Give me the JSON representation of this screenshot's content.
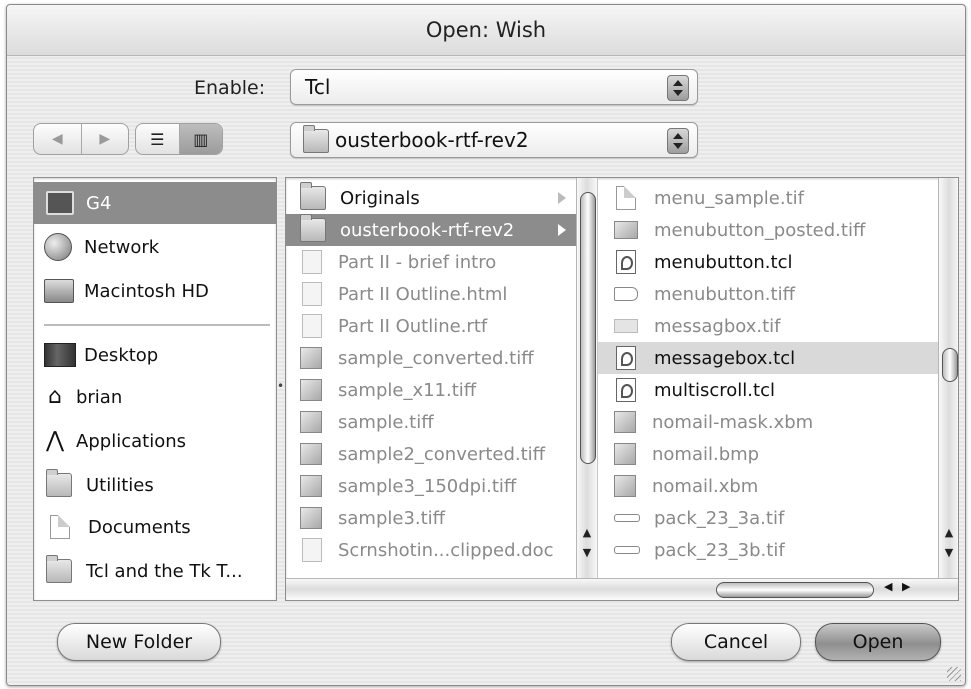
{
  "window": {
    "title": "Open: Wish"
  },
  "enable": {
    "label": "Enable:",
    "value": "Tcl"
  },
  "nav": {
    "back_icon": "back-arrow-icon",
    "forward_icon": "forward-arrow-icon"
  },
  "view": {
    "list_icon": "list-view-icon",
    "column_icon": "column-view-icon",
    "active": "column"
  },
  "location": {
    "value": "ousterbook-rtf-rev2"
  },
  "sidebar": {
    "items": [
      {
        "label": "G4",
        "icon": "computer-icon"
      },
      {
        "label": "Network",
        "icon": "network-globe-icon"
      },
      {
        "label": "Macintosh HD",
        "icon": "hard-disk-icon"
      },
      {
        "label": "Desktop",
        "icon": "desktop-icon"
      },
      {
        "label": "brian",
        "icon": "home-icon"
      },
      {
        "label": "Applications",
        "icon": "applications-icon"
      },
      {
        "label": "Utilities",
        "icon": "folder-icon"
      },
      {
        "label": "Documents",
        "icon": "document-icon"
      },
      {
        "label": "Tcl and the Tk T...",
        "icon": "folder-icon"
      }
    ]
  },
  "column1": {
    "items": [
      {
        "label": "Originals",
        "icon": "folder-icon",
        "enabled": true,
        "has_children": true
      },
      {
        "label": "ousterbook-rtf-rev2",
        "icon": "folder-icon",
        "enabled": true,
        "selected": true,
        "has_children": true
      },
      {
        "label": "Part II - brief intro",
        "icon": "document-icon"
      },
      {
        "label": "Part II Outline.html",
        "icon": "html-document-icon"
      },
      {
        "label": "Part II Outline.rtf",
        "icon": "document-icon"
      },
      {
        "label": "sample_converted.tiff",
        "icon": "image-icon"
      },
      {
        "label": "sample_x11.tiff",
        "icon": "image-icon"
      },
      {
        "label": "sample.tiff",
        "icon": "image-icon"
      },
      {
        "label": "sample2_converted.tiff",
        "icon": "image-icon"
      },
      {
        "label": "sample3_150dpi.tiff",
        "icon": "image-icon"
      },
      {
        "label": "sample3.tiff",
        "icon": "image-icon"
      },
      {
        "label": "Scrnshotin...clipped.doc",
        "icon": "document-icon"
      }
    ]
  },
  "column2": {
    "items": [
      {
        "label": "menu_sample.tif",
        "icon": "document-icon"
      },
      {
        "label": "menubutton_posted.tiff",
        "icon": "image-icon"
      },
      {
        "label": "menubutton.tcl",
        "icon": "tcl-script-icon",
        "enabled": true
      },
      {
        "label": "menubutton.tiff",
        "icon": "image-icon"
      },
      {
        "label": "messagbox.tif",
        "icon": "image-icon"
      },
      {
        "label": "messagebox.tcl",
        "icon": "tcl-script-icon",
        "enabled": true,
        "highlighted": true
      },
      {
        "label": "multiscroll.tcl",
        "icon": "tcl-script-icon",
        "enabled": true
      },
      {
        "label": "nomail-mask.xbm",
        "icon": "image-icon"
      },
      {
        "label": "nomail.bmp",
        "icon": "image-icon"
      },
      {
        "label": "nomail.xbm",
        "icon": "image-icon"
      },
      {
        "label": "pack_23_3a.tif",
        "icon": "image-icon"
      },
      {
        "label": "pack_23_3b.tif",
        "icon": "image-icon"
      }
    ]
  },
  "buttons": {
    "new_folder": "New Folder",
    "cancel": "Cancel",
    "open": "Open"
  },
  "colors": {
    "selection": "#8c8c8c",
    "highlight": "#d9d9d9",
    "disabled_text": "#8a8a8a"
  }
}
